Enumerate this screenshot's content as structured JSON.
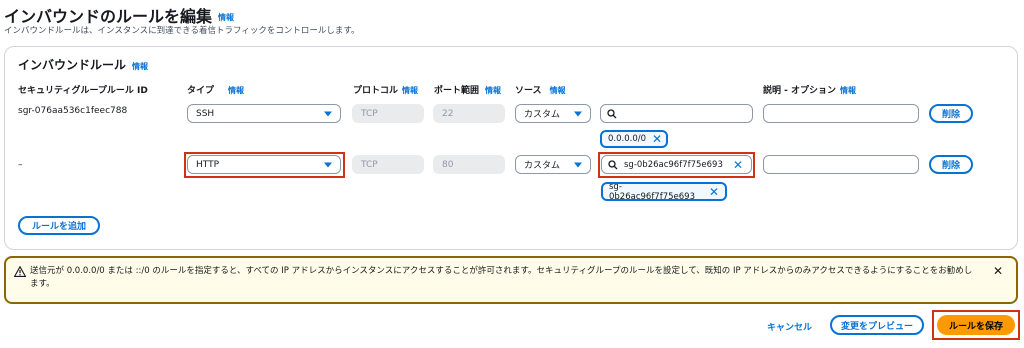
{
  "page": {
    "title": "インバウンドのルールを編集",
    "info": "情報",
    "description": "インバウンドルールは、インスタンスに到達できる着信トラフィックをコントロールします。"
  },
  "section": {
    "title": "インバウンドルール",
    "info": "情報",
    "headers": {
      "rule_id": "セキュリティグループルール ID",
      "type": "タイプ",
      "protocol": "プロトコル",
      "port_range": "ポート範囲",
      "source": "ソース",
      "description": "説明 - オプション"
    }
  },
  "rules": [
    {
      "rule_id": "sgr-076aa536c1feec788",
      "type": "SSH",
      "protocol": "TCP",
      "port": "22",
      "source_type": "カスタム",
      "search_value": "",
      "token": "0.0.0.0/0",
      "description": "",
      "delete_label": "削除"
    },
    {
      "rule_id": "–",
      "type": "HTTP",
      "protocol": "TCP",
      "port": "80",
      "source_type": "カスタム",
      "search_value": "sg-0b26ac96f7f75e693",
      "token": "sg-0b26ac96f7f75e693",
      "description": "",
      "delete_label": "削除"
    }
  ],
  "add_rule_label": "ルールを追加",
  "warning": {
    "text": "送信元が 0.0.0.0/0 または ::/0 のルールを指定すると、すべての IP アドレスからインスタンスにアクセスすることが許可されます。セキュリティグループのルールを設定して、既知の IP アドレスからのみアクセスできるようにすることをお勧めします。"
  },
  "footer": {
    "cancel": "キャンセル",
    "preview": "変更をプレビュー",
    "save": "ルールを保存"
  },
  "colors": {
    "link": "#0972d3",
    "primary": "#ff9900",
    "highlight": "#d13212",
    "warning_border": "#8d6605"
  }
}
